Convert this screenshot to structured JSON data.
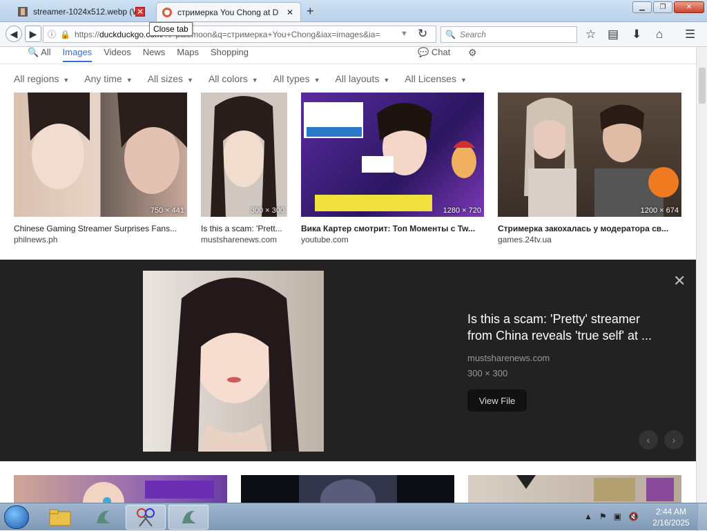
{
  "browser": {
    "tabs": [
      {
        "title": "streamer-1024x512.webp (W",
        "active": false
      },
      {
        "title": "стримерка You Chong at D",
        "active": true
      }
    ],
    "tooltip": "Close tab",
    "url_prefix": "https://",
    "url_host": "duckduckgo.com",
    "url_rest": "/?t=palemoon&q=стримерка+You+Chong&iax=images&ia=",
    "search_placeholder": "Search",
    "window_buttons": [
      "minimize",
      "maximize",
      "close"
    ]
  },
  "ddg": {
    "nav": {
      "all": "All",
      "images": "Images",
      "videos": "Videos",
      "news": "News",
      "maps": "Maps",
      "shopping": "Shopping",
      "chat": "Chat"
    },
    "filters": [
      "All regions",
      "Any time",
      "All sizes",
      "All colors",
      "All types",
      "All layouts",
      "All Licenses"
    ],
    "results": [
      {
        "title": "Chinese Gaming Streamer Surprises Fans...",
        "domain": "philnews.ph",
        "dims": "750 × 441"
      },
      {
        "title": "Is this a scam: 'Prett...",
        "domain": "mustsharenews.com",
        "dims": "300 × 300"
      },
      {
        "title": "Вика Картер смотрит: Топ Моменты с Tw...",
        "domain": "youtube.com",
        "dims": "1280 × 720"
      },
      {
        "title": "Стримерка закохалась у модератора св...",
        "domain": "games.24tv.ua",
        "dims": "1200 × 674"
      }
    ],
    "detail": {
      "title": "Is this a scam: 'Pretty' streamer from China reveals 'true self' at ...",
      "domain": "mustsharenews.com",
      "dims": "300 × 300",
      "view_button": "View File"
    }
  },
  "taskbar": {
    "time": "2:44 AM",
    "date": "2/16/2025"
  },
  "colors": {
    "accent": "#3969ef",
    "detail_bg": "#222222"
  }
}
